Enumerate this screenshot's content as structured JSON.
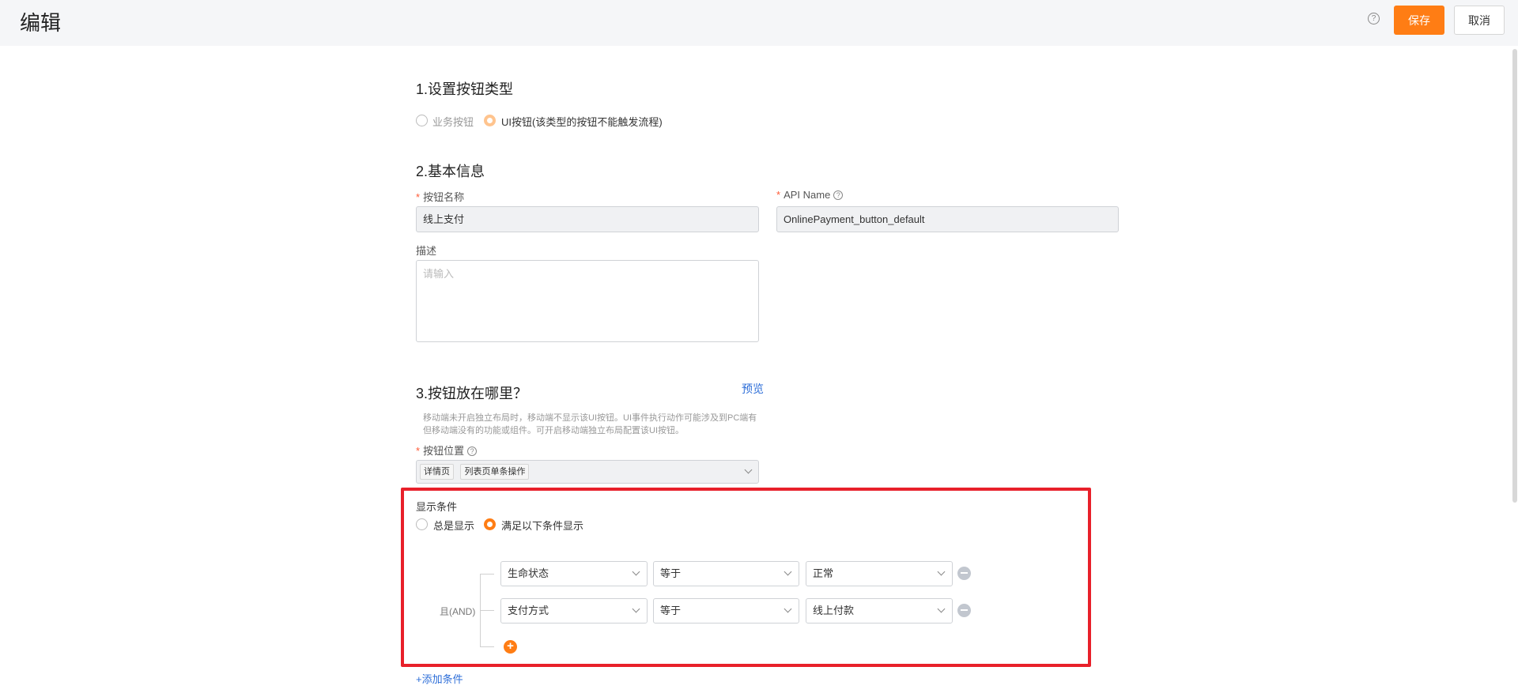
{
  "header": {
    "title": "编辑",
    "help_icon": "question-circle-icon",
    "save_label": "保存",
    "cancel_label": "取消",
    "accent": "#ff7d14"
  },
  "section1": {
    "title": "1.设置按钮类型",
    "options": [
      {
        "label": "业务按钮",
        "selected": false,
        "disabled": true
      },
      {
        "label": "UI按钮(该类型的按钮不能触发流程)",
        "selected": true
      }
    ]
  },
  "section2": {
    "title": "2.基本信息",
    "name_label": "按钮名称",
    "name_value": "线上支付",
    "api_label": "API Name",
    "api_value": "OnlinePayment_button_default",
    "desc_label": "描述",
    "desc_placeholder": "请输入",
    "required_mark": "*"
  },
  "section3": {
    "title": "3.按钮放在哪里？",
    "preview_link": "预览",
    "hint_line1": "移动端未开启独立布局时，移动端不显示该UI按钮。UI事件执行动作可能涉及到PC端有",
    "hint_line2": "但移动端没有的功能或组件。可开启移动端独立布局配置该UI按钮。",
    "position_label": "按钮位置",
    "position_tags": [
      "详情页",
      "列表页单条操作"
    ]
  },
  "display": {
    "title": "显示条件",
    "options": [
      {
        "label": "总是显示",
        "selected": false
      },
      {
        "label": "满足以下条件显示",
        "selected": true
      }
    ],
    "logic_label": "且(AND)",
    "conditions": [
      {
        "field": "生命状态",
        "operator": "等于",
        "value": "正常"
      },
      {
        "field": "支付方式",
        "operator": "等于",
        "value": "线上付款"
      }
    ],
    "add_condition_link": "+添加条件",
    "highlight_color": "#e8202a"
  }
}
